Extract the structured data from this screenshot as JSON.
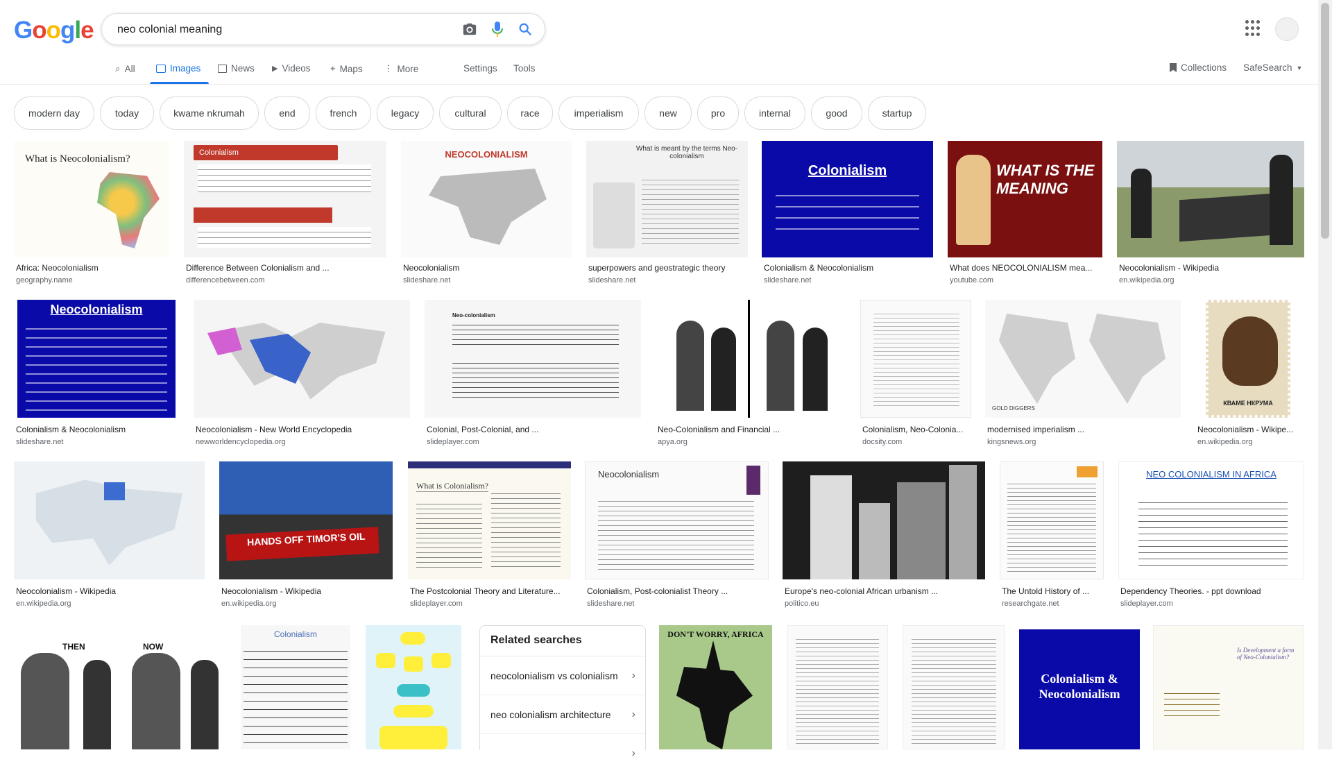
{
  "logo": "Google",
  "search": {
    "value": "neo colonial meaning"
  },
  "tabs": [
    {
      "label": "All"
    },
    {
      "label": "Images"
    },
    {
      "label": "News"
    },
    {
      "label": "Videos"
    },
    {
      "label": "Maps"
    },
    {
      "label": "More"
    }
  ],
  "settings_label": "Settings",
  "tools_label": "Tools",
  "collections_label": "Collections",
  "safesearch_label": "SafeSearch",
  "chips": [
    "modern day",
    "today",
    "kwame nkrumah",
    "end",
    "french",
    "legacy",
    "cultural",
    "race",
    "imperialism",
    "new",
    "pro",
    "internal",
    "good",
    "startup"
  ],
  "results": [
    {
      "title": "Africa: Neocolonialism",
      "source": "geography.name",
      "thumb_text": "What is Neocolonialism?"
    },
    {
      "title": "Difference Between Colonialism and ...",
      "source": "differencebetween.com",
      "thumb_text": "Colonialism"
    },
    {
      "title": "Neocolonialism",
      "source": "slideshare.net",
      "thumb_text": "NEOCOLONIALISM"
    },
    {
      "title": "superpowers and geostrategic theory",
      "source": "slideshare.net",
      "thumb_text": "What is meant by the terms Neo-colonialism"
    },
    {
      "title": "Colonialism & Neocolonialism",
      "source": "slideshare.net",
      "thumb_text": "Colonialism"
    },
    {
      "title": "What does NEOCOLONIALISM mea...",
      "source": "youtube.com",
      "thumb_text": "WHAT IS THE MEANING"
    },
    {
      "title": "Neocolonialism - Wikipedia",
      "source": "en.wikipedia.org",
      "thumb_text": ""
    },
    {
      "title": "Colonialism & Neocolonialism",
      "source": "slideshare.net",
      "thumb_text": "Neocolonialism"
    },
    {
      "title": "Neocolonialism - New World Encyclopedia",
      "source": "newworldencyclopedia.org",
      "thumb_text": ""
    },
    {
      "title": "Colonial, Post-Colonial, and ...",
      "source": "slideplayer.com",
      "thumb_text": "Neo-colonialism"
    },
    {
      "title": "Neo-Colonialism and Financial ...",
      "source": "apya.org",
      "thumb_text": ""
    },
    {
      "title": "Colonialism, Neo-Colonia...",
      "source": "docsity.com",
      "thumb_text": ""
    },
    {
      "title": "modernised imperialism ...",
      "source": "kingsnews.org",
      "thumb_text": "GOLD DIGGERS"
    },
    {
      "title": "Neocolonialism - Wikipe...",
      "source": "en.wikipedia.org",
      "thumb_text": "КВАМЕ НКРУМА"
    },
    {
      "title": "Neocolonialism - Wikipedia",
      "source": "en.wikipedia.org",
      "thumb_text": ""
    },
    {
      "title": "Neocolonialism - Wikipedia",
      "source": "en.wikipedia.org",
      "thumb_text": "HANDS OFF TIMOR'S OIL"
    },
    {
      "title": "The Postcolonial Theory and Literature...",
      "source": "slideplayer.com",
      "thumb_text": "What is Colonialism?"
    },
    {
      "title": "Colonialism, Post-colonialist Theory ...",
      "source": "slideshare.net",
      "thumb_text": "Neocolonialism"
    },
    {
      "title": "Europe's neo-colonial African urbanism ...",
      "source": "politico.eu",
      "thumb_text": ""
    },
    {
      "title": "The Untold History of ...",
      "source": "researchgate.net",
      "thumb_text": ""
    },
    {
      "title": "Dependency Theories. - ppt download",
      "source": "slideplayer.com",
      "thumb_text": "NEO COLONIALISM IN AFRICA"
    },
    {
      "title": "",
      "source": "",
      "thumb_text": "THEN NOW"
    },
    {
      "title": "",
      "source": "",
      "thumb_text": "Colonialism"
    },
    {
      "title": "",
      "source": "",
      "thumb_text": ""
    },
    {
      "title": "",
      "source": "",
      "thumb_text": "DON'T WORRY, AFRICA"
    },
    {
      "title": "",
      "source": "",
      "thumb_text": ""
    },
    {
      "title": "",
      "source": "",
      "thumb_text": ""
    },
    {
      "title": "",
      "source": "",
      "thumb_text": "Colonialism & Neocolonialism"
    },
    {
      "title": "",
      "source": "",
      "thumb_text": "Is Development a form of Neo-Colonialism?"
    }
  ],
  "related": {
    "heading": "Related searches",
    "items": [
      "neocolonialism vs colonialism",
      "neo colonialism architecture"
    ]
  },
  "colors": {
    "accent": "#1a73e8",
    "chip_border": "#dadce0",
    "text_secondary": "#5f6368"
  }
}
